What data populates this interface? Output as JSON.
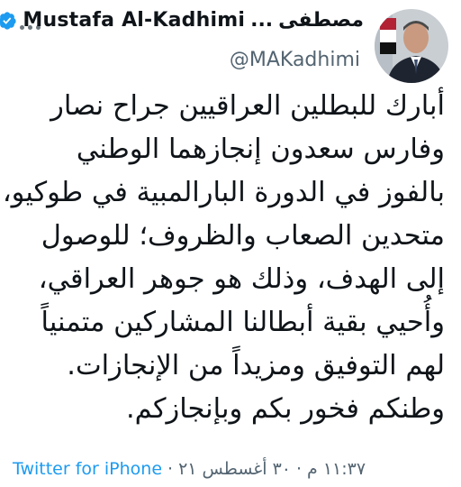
{
  "author": {
    "name_ar": "مصطفى",
    "ellipsis": "...",
    "name_en": "Mustafa Al-Kadhimi",
    "handle": "@MAKadhimi",
    "verified": true
  },
  "tweet": {
    "lines": [
      "أبارك للبطلين العراقيين جراح نصار",
      "وفارس سعدون إنجازهما الوطني",
      "بالفوز في الدورة البارالمبية في طوكيو،",
      "متحدين الصعاب والظروف؛ للوصول",
      "إلى الهدف، وذلك هو جوهر العراقي،",
      "وأُحيي بقية أبطالنا المشاركين متمنياً",
      "لهم التوفيق ومزيداً من الإنجازات.",
      "وطنكم فخور بكم وبإنجازكم."
    ]
  },
  "meta": {
    "time": "١١:٣٧ م",
    "date": "٣٠ أغسطس ٢١",
    "separator": "·",
    "source": "Twitter for iPhone"
  },
  "icons": {
    "more": "more-horizontal-icon",
    "verified": "verified-badge-icon"
  },
  "colors": {
    "accent": "#1d9bf0",
    "secondary_text": "#536471",
    "text": "#0f1419"
  }
}
